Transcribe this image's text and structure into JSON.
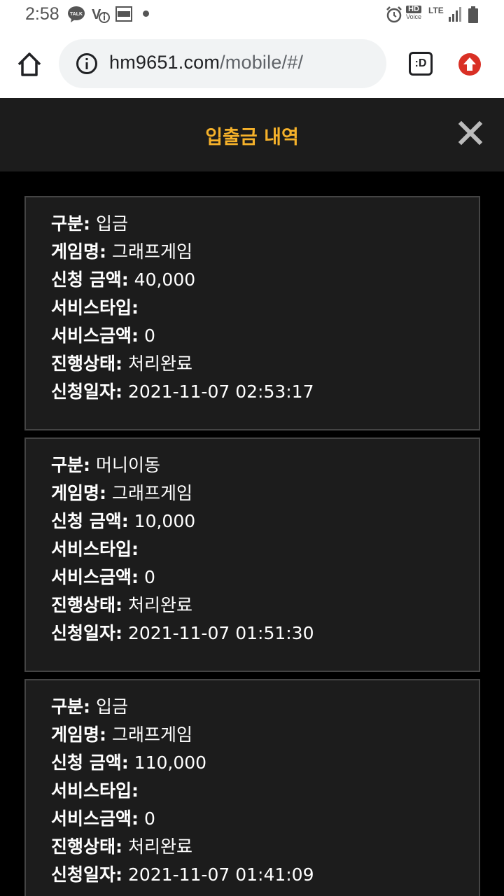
{
  "status_bar": {
    "time": "2:58",
    "hd_top": "HD",
    "hd_bottom": "Voice",
    "network": "LTE"
  },
  "browser": {
    "url_host": "hm9651.com",
    "url_path": "/mobile/#/",
    "tabs_label": ":D"
  },
  "modal": {
    "title": "입출금 내역"
  },
  "labels": {
    "type": "구분",
    "game": "게임명",
    "amount": "신청 금액",
    "service_type": "서비스타입",
    "service_amount": "서비스금액",
    "status": "진행상태",
    "date": "신청일자"
  },
  "records": [
    {
      "type": "입금",
      "game": "그래프게임",
      "amount": "40,000",
      "service_type": "",
      "service_amount": "0",
      "status": "처리완료",
      "date": "2021-11-07 02:53:17"
    },
    {
      "type": "머니이동",
      "game": "그래프게임",
      "amount": "10,000",
      "service_type": "",
      "service_amount": "0",
      "status": "처리완료",
      "date": "2021-11-07 01:51:30"
    },
    {
      "type": "입금",
      "game": "그래프게임",
      "amount": "110,000",
      "service_type": "",
      "service_amount": "0",
      "status": "처리완료",
      "date": "2021-11-07 01:41:09"
    }
  ],
  "colors": {
    "accent": "#f5b12a",
    "modal_bg": "#1c1c1c",
    "page_bg": "#000000",
    "card_border": "#444444"
  }
}
